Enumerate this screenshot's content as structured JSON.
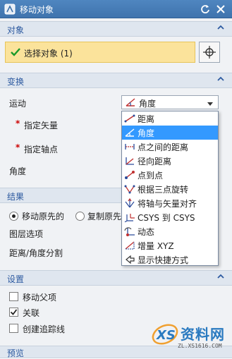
{
  "window": {
    "title": "移动对象"
  },
  "sections": {
    "object": {
      "title": "对象",
      "select_label": "选择对象 (1)"
    },
    "transform": {
      "title": "变换",
      "motion_label": "运动",
      "motion_value": "角度",
      "specify_vector": "指定矢量",
      "specify_axis_point": "指定轴点",
      "angle_label": "角度",
      "menu_items": [
        {
          "label": "距离",
          "icon": "distance-icon"
        },
        {
          "label": "角度",
          "icon": "angle-icon"
        },
        {
          "label": "点之间的距离",
          "icon": "point-distance-icon"
        },
        {
          "label": "径向距离",
          "icon": "radial-distance-icon"
        },
        {
          "label": "点到点",
          "icon": "point-to-point-icon"
        },
        {
          "label": "根据三点旋转",
          "icon": "three-point-rotate-icon"
        },
        {
          "label": "将轴与矢量对齐",
          "icon": "align-axis-icon"
        },
        {
          "label": "CSYS 到 CSYS",
          "icon": "csys-icon"
        },
        {
          "label": "动态",
          "icon": "dynamic-icon"
        },
        {
          "label": "增量 XYZ",
          "icon": "delta-xyz-icon"
        },
        {
          "label": "显示快捷方式",
          "icon": "shortcut-icon"
        }
      ]
    },
    "result": {
      "title": "结果",
      "move_original": "移动原先的",
      "copy_original": "复制原先",
      "layer_option": "图层选项",
      "distance_angle_split": "距离/角度分割"
    },
    "settings": {
      "title": "设置",
      "move_parent": "移动父项",
      "associative": "关联",
      "create_trace": "创建追踪线",
      "associative_checked": true
    },
    "preview": {
      "title": "预览"
    }
  },
  "watermark": {
    "brand": "资料网",
    "url": "ZL.XS1616.COM",
    "logo_text": "XS"
  },
  "colors": {
    "accent": "#2d5aa0",
    "selection": "#3399ff",
    "highlight": "#fbe39b"
  }
}
